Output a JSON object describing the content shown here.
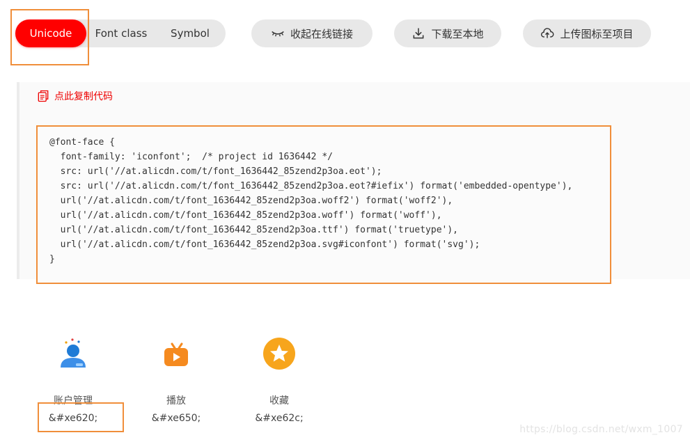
{
  "tabs": {
    "unicode": "Unicode",
    "font_class": "Font class",
    "symbol": "Symbol"
  },
  "actions": {
    "collapse_link": "收起在线链接",
    "download": "下载至本地",
    "upload": "上传图标至项目"
  },
  "copy_code_label": "点此复制代码",
  "code_block": "@font-face {\n  font-family: 'iconfont';  /* project id 1636442 */\n  src: url('//at.alicdn.com/t/font_1636442_85zend2p3oa.eot');\n  src: url('//at.alicdn.com/t/font_1636442_85zend2p3oa.eot?#iefix') format('embedded-opentype'),\n  url('//at.alicdn.com/t/font_1636442_85zend2p3oa.woff2') format('woff2'),\n  url('//at.alicdn.com/t/font_1636442_85zend2p3oa.woff') format('woff'),\n  url('//at.alicdn.com/t/font_1636442_85zend2p3oa.ttf') format('truetype'),\n  url('//at.alicdn.com/t/font_1636442_85zend2p3oa.svg#iconfont') format('svg');\n}",
  "icons": [
    {
      "name": "账户管理",
      "code": "&#xe620;",
      "icon": "account-user-icon"
    },
    {
      "name": "播放",
      "code": "&#xe650;",
      "icon": "play-tv-icon"
    },
    {
      "name": "收藏",
      "code": "&#xe62c;",
      "icon": "star-favorite-icon"
    }
  ],
  "watermark": "https://blog.csdn.net/wxm_1007",
  "colors": {
    "accent": "#ff0000",
    "highlight": "#f08e3a",
    "pill_bg": "#e8e8e8"
  }
}
